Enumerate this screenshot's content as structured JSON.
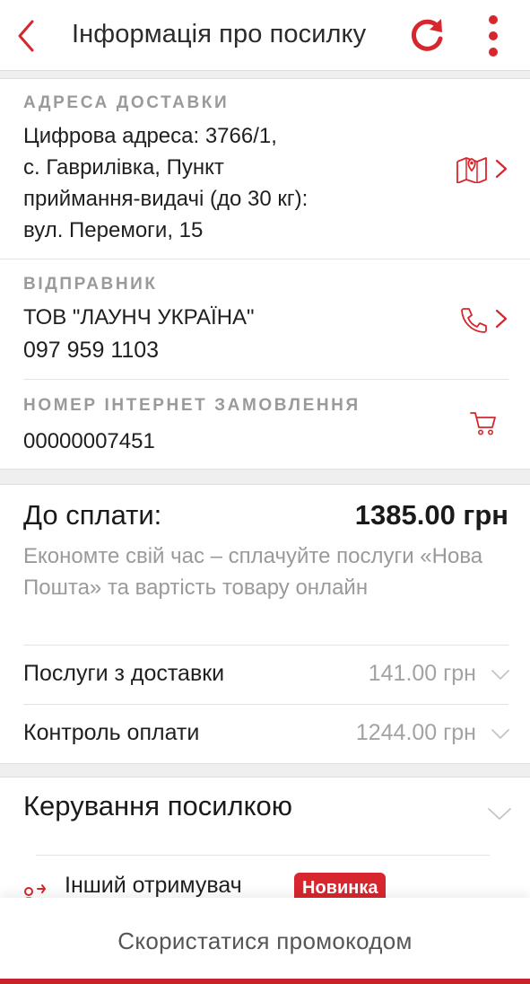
{
  "header": {
    "title": "Інформація про посилку",
    "back_icon": "chevron-left-icon",
    "refresh_icon": "refresh-icon",
    "menu_icon": "more-vertical-icon"
  },
  "delivery_address": {
    "label": "АДРЕСА ДОСТАВКИ",
    "lines": [
      "Цифрова адреса: 3766/1,",
      "с. Гаврилівка, Пункт",
      "приймання-видачі (до 30 кг):",
      "вул. Перемоги, 15"
    ],
    "action_icon": "map-pin-icon"
  },
  "sender": {
    "label": "ВІДПРАВНИК",
    "name": "ТОВ \"ЛАУНЧ УКРАЇНА\"",
    "phone": "097 959 1103",
    "action_icon": "phone-icon"
  },
  "order": {
    "label": "НОМЕР ІНТЕРНЕТ ЗАМОВЛЕННЯ",
    "number": "00000007451",
    "icon": "cart-icon"
  },
  "payment": {
    "title": "До сплати:",
    "amount": "1385.00 грн",
    "note": "Економте свій час – сплачуйте послуги «Нова Пошта» та вартість товару онлайн",
    "rows": [
      {
        "label": "Послуги з доставки",
        "value": "141.00 грн"
      },
      {
        "label": "Контроль оплати",
        "value": "1244.00 грн"
      }
    ]
  },
  "manage": {
    "title": "Керування посилкою",
    "items": [
      {
        "label": "Інший отримувач",
        "badge": "Новинка",
        "icon": "user-switch-icon"
      }
    ]
  },
  "promo": {
    "label": "Скористатися промокодом"
  },
  "colors": {
    "accent": "#d8262e",
    "muted": "#9a9a9a",
    "text": "#1f1f1f"
  }
}
